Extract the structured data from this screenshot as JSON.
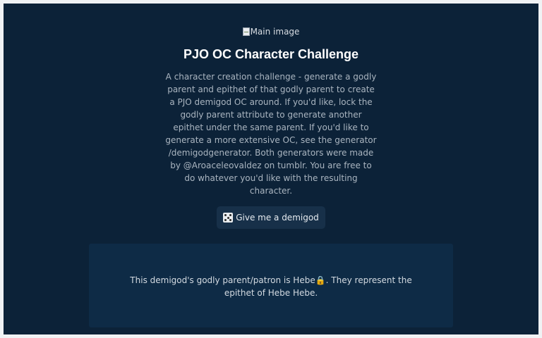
{
  "main_image": {
    "alt": "Main image"
  },
  "title": "PJO OC Character Challenge",
  "description": "A character creation challenge - generate a godly parent and epithet of that godly parent to create a PJO demigod OC around. If you'd like, lock the godly parent attribute to generate another epithet under the same parent. If you'd like to generate a more extensive OC, see the generator /demigodgenerator. Both generators were made by @Aroaceleovaldez on tumblr. You are free to do whatever you'd like with the resulting character.",
  "generate_button": {
    "icon": "dice-icon",
    "label": "Give me a demigod"
  },
  "result": {
    "text": "This demigod's godly parent/patron is Hebe🔒. They represent the epithet of Hebe Hebe."
  }
}
